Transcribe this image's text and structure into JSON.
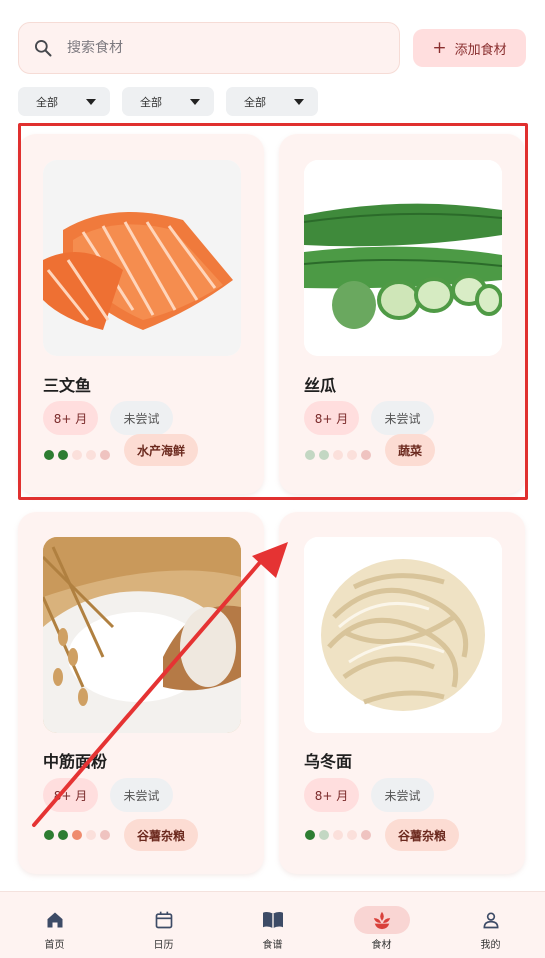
{
  "search": {
    "placeholder": "搜索食材",
    "value": ""
  },
  "add_button": {
    "icon": "plus-icon",
    "label": "添加食材"
  },
  "filters": [
    {
      "label": "全部"
    },
    {
      "label": "全部"
    },
    {
      "label": "全部"
    }
  ],
  "foods": [
    {
      "name": "三文鱼",
      "age": "8+ 月",
      "status": "未尝试",
      "category": "水产海鲜",
      "dots": [
        "#2e7d32",
        "#2e7d32",
        "#fbe0db",
        "#fbe0db",
        "#efc3c0"
      ]
    },
    {
      "name": "丝瓜",
      "age": "8+ 月",
      "status": "未尝试",
      "category": "蔬菜",
      "dots": [
        "#c3d7c3",
        "#c3d7c3",
        "#fbe0db",
        "#fbe0db",
        "#efc3c0"
      ]
    },
    {
      "name": "中筋面粉",
      "age": "8+ 月",
      "status": "未尝试",
      "category": "谷薯杂粮",
      "dots": [
        "#2e7d32",
        "#2e7d32",
        "#ef8b6d",
        "#fbe0db",
        "#efc3c0"
      ]
    },
    {
      "name": "乌冬面",
      "age": "8+ 月",
      "status": "未尝试",
      "category": "谷薯杂粮",
      "dots": [
        "#2e7d32",
        "#c3d7c3",
        "#fbe0db",
        "#fbe0db",
        "#efc3c0"
      ]
    }
  ],
  "nav": [
    {
      "label": "首页",
      "icon": "home-icon"
    },
    {
      "label": "日历",
      "icon": "calendar-icon"
    },
    {
      "label": "食谱",
      "icon": "book-icon"
    },
    {
      "label": "食材",
      "icon": "food-icon",
      "active": true
    },
    {
      "label": "我的",
      "icon": "person-icon"
    }
  ],
  "colors": {
    "accent": "#e05555",
    "highlight_box": "#e0302f",
    "card_bg": "#fef3f1"
  }
}
